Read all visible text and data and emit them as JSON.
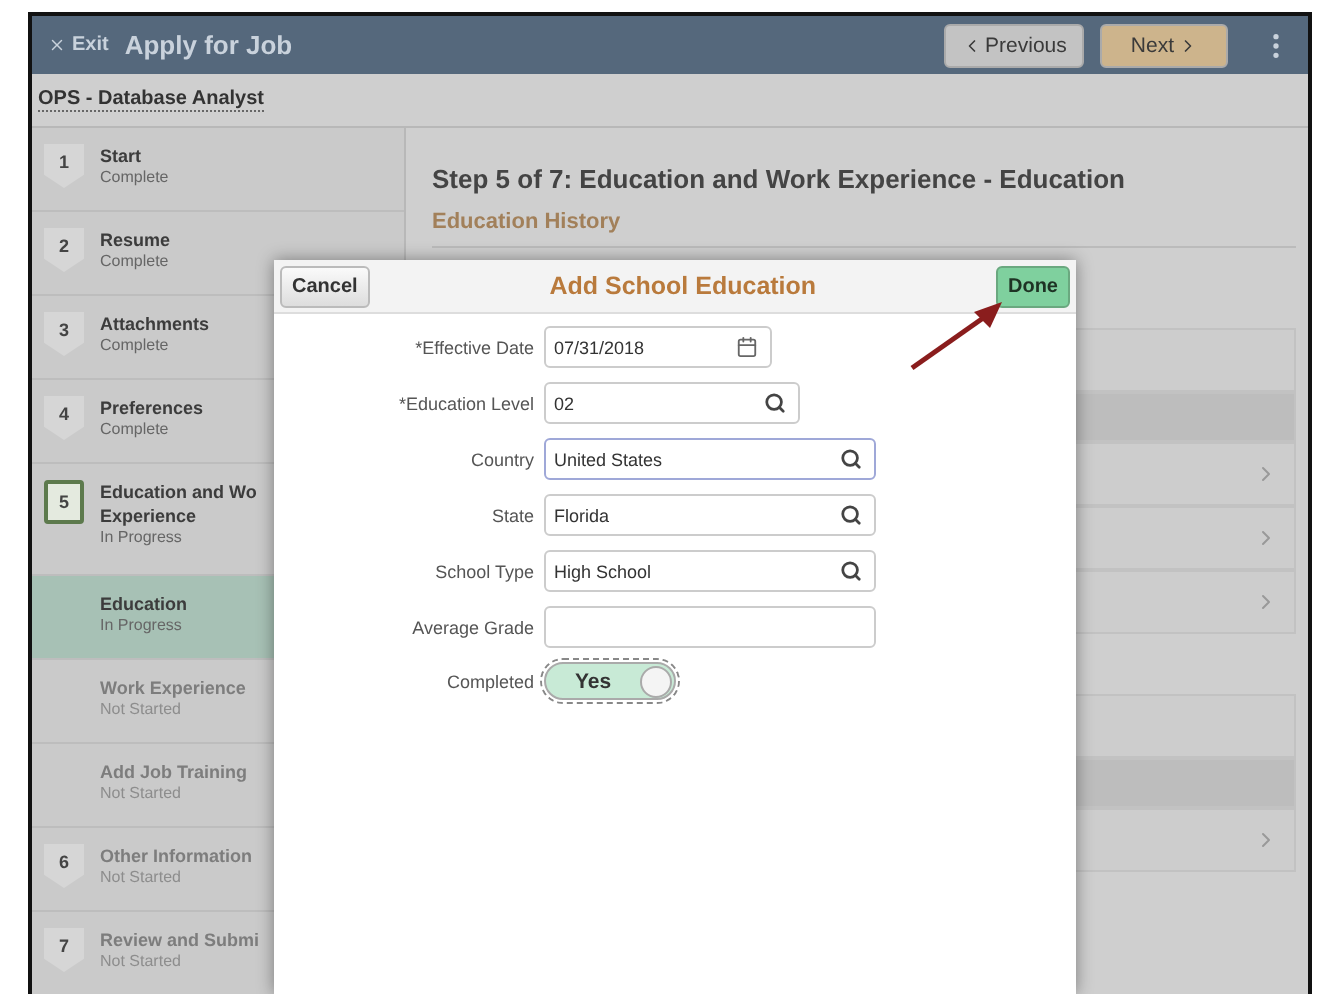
{
  "header": {
    "exit": "Exit",
    "title": "Apply for Job",
    "previous": "Previous",
    "next": "Next"
  },
  "job_title": "OPS - Database Analyst",
  "sidebar": {
    "items": [
      {
        "kind": "step",
        "number": "1",
        "title": "Start",
        "status": "Complete",
        "current": false,
        "selected": false,
        "started": true
      },
      {
        "kind": "step",
        "number": "2",
        "title": "Resume",
        "status": "Complete",
        "current": false,
        "selected": false,
        "started": true
      },
      {
        "kind": "step",
        "number": "3",
        "title": "Attachments",
        "status": "Complete",
        "current": false,
        "selected": false,
        "started": true
      },
      {
        "kind": "step",
        "number": "4",
        "title": "Preferences",
        "status": "Complete",
        "current": false,
        "selected": false,
        "started": true
      },
      {
        "kind": "step",
        "number": "5",
        "title": "Education and Wo",
        "title_line_2": "Experience",
        "status": "In Progress",
        "current": true,
        "selected": false,
        "started": true
      },
      {
        "kind": "substep",
        "title": "Education",
        "status": "In Progress",
        "selected": true,
        "started": true
      },
      {
        "kind": "substep",
        "title": "Work Experience",
        "status": "Not Started",
        "selected": false,
        "started": false
      },
      {
        "kind": "substep",
        "title": "Add Job Training",
        "status": "Not Started",
        "selected": false,
        "started": false
      },
      {
        "kind": "step",
        "number": "6",
        "title": "Other Information",
        "status": "Not Started",
        "current": false,
        "selected": false,
        "started": false
      },
      {
        "kind": "step",
        "number": "7",
        "title": "Review and Submi",
        "status": "Not Started",
        "current": false,
        "selected": false,
        "started": false
      }
    ]
  },
  "main": {
    "step_heading": "Step 5 of 7: Education and Work Experience - Education",
    "section_heading": "Education History",
    "rows": [
      {
        "kind": "header"
      },
      {
        "kind": "subheader"
      },
      {
        "kind": "link"
      },
      {
        "kind": "link"
      },
      {
        "kind": "link"
      },
      {
        "kind": "gap"
      },
      {
        "kind": "header"
      },
      {
        "kind": "subheader"
      },
      {
        "kind": "link"
      }
    ]
  },
  "dialog": {
    "title": "Add School Education",
    "cancel": "Cancel",
    "done": "Done",
    "fields": [
      {
        "kind": "date",
        "label": "*Effective Date",
        "value": "07/31/2018",
        "focused": false
      },
      {
        "kind": "lookup_short",
        "label": "*Education Level",
        "value": "02",
        "focused": false
      },
      {
        "kind": "lookup",
        "label": "Country",
        "value": "United States",
        "focused": true
      },
      {
        "kind": "lookup",
        "label": "State",
        "value": "Florida",
        "focused": false
      },
      {
        "kind": "lookup",
        "label": "School Type",
        "value": "High School",
        "focused": false
      },
      {
        "kind": "text",
        "label": "Average Grade",
        "focused": false
      },
      {
        "kind": "toggle",
        "label": "Completed",
        "value": "Yes",
        "on": true
      }
    ]
  }
}
